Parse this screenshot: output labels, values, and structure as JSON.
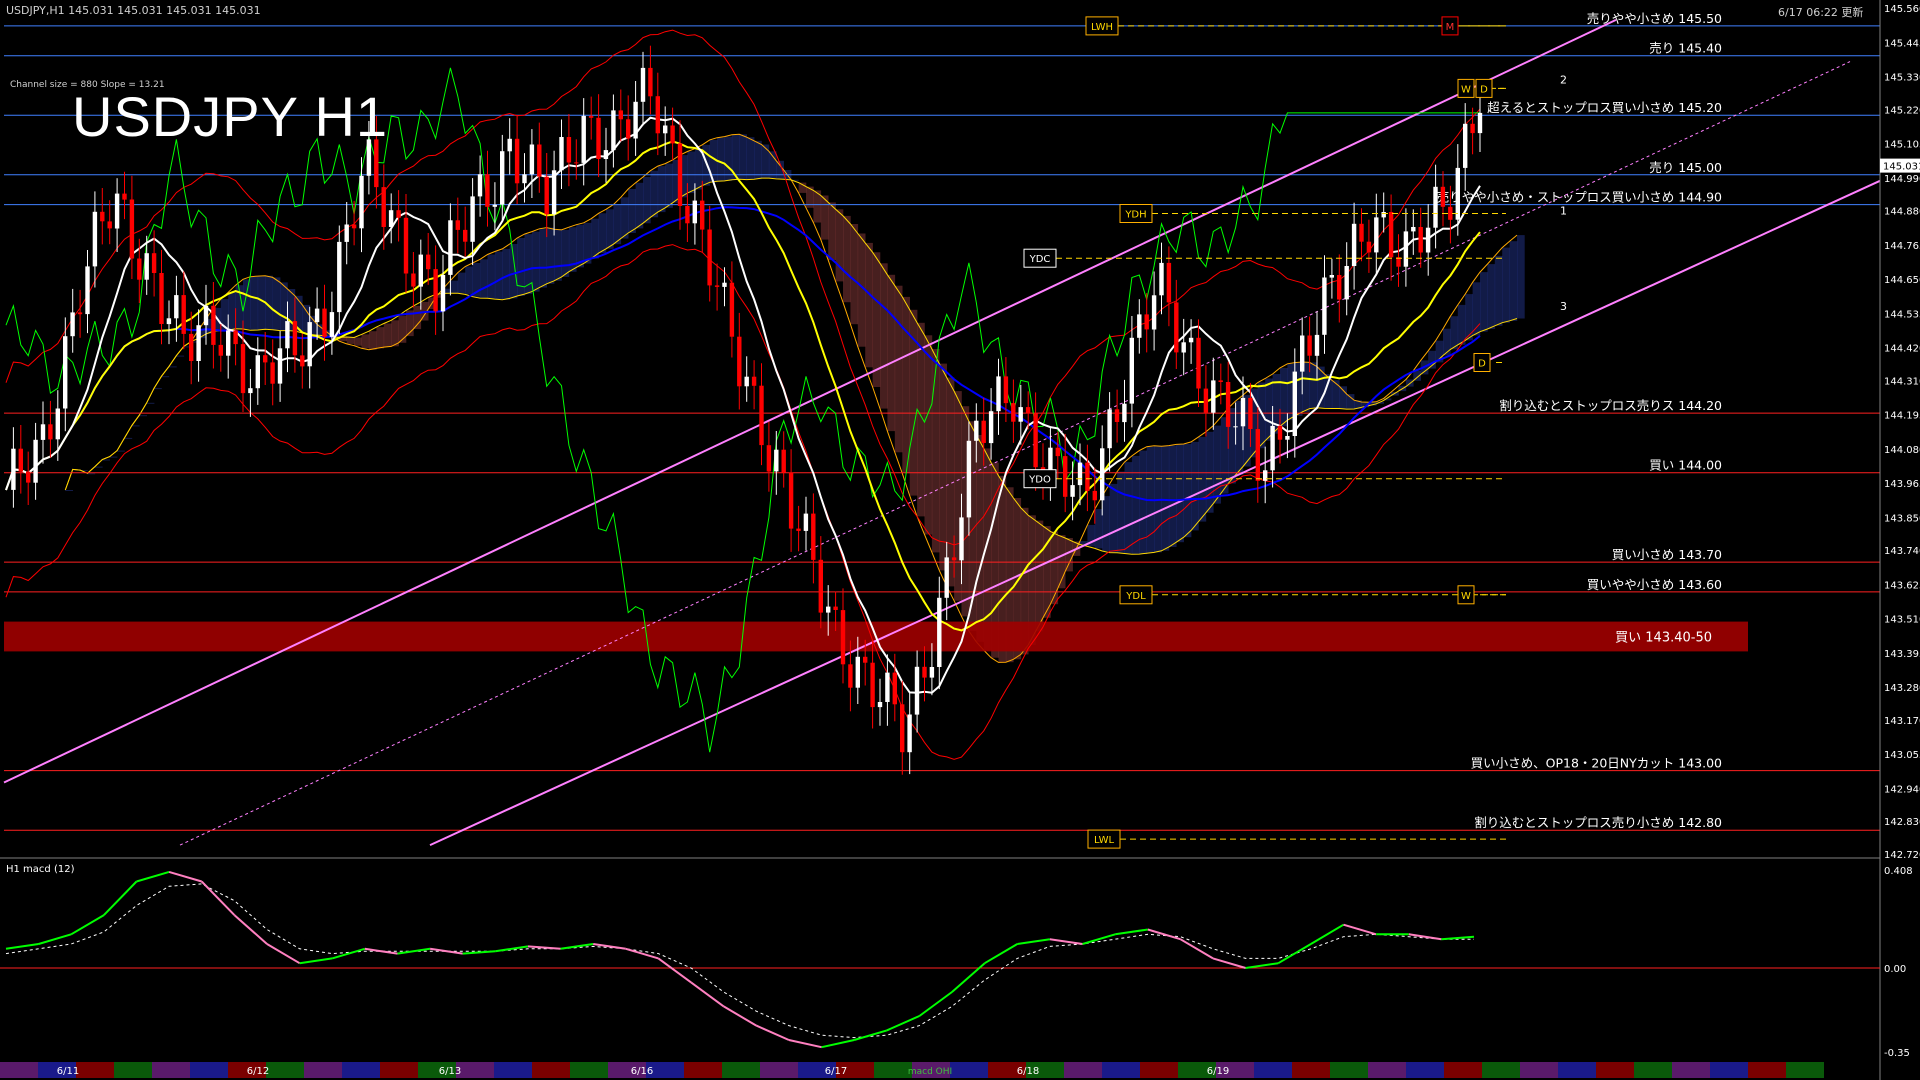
{
  "header": {
    "symbol_info": "USDJPY,H1  145.031 145.031 145.031 145.031",
    "update_time": "6/17 06:22 更新",
    "channel_info": "Channel size = 880 Slope = 13.21",
    "big_title": "USDJPY H1"
  },
  "colors": {
    "bg": "#000000",
    "bull_candle": "#ffffff",
    "bear_candle": "#ff0000",
    "ma_fast": "#ffffff",
    "ma_mid": "#ffff00",
    "ma_slow": "#0000ff",
    "chikou": "#00ff00",
    "bollinger": "#ff0000",
    "channel": "#ff80ff",
    "res_line": "#4080ff",
    "sup_line": "#ff2020",
    "buy_zone": "#a00000",
    "kumo_bull": "#4060ff",
    "kumo_bear": "#ff7070",
    "macd": "#00ff00",
    "macd_neg": "#ff80c0",
    "signal": "#ffffff"
  },
  "chart_data": [
    {
      "type": "candlestick",
      "symbol": "USDJPY",
      "timeframe": "H1",
      "ylim": [
        142.72,
        145.56
      ],
      "y_ticks": [
        "145.560",
        "145.445",
        "145.330",
        "145.220",
        "145.105",
        "144.990",
        "144.880",
        "144.765",
        "144.650",
        "144.535",
        "144.420",
        "144.310",
        "144.195",
        "144.080",
        "143.965",
        "143.850",
        "143.740",
        "143.625",
        "143.510",
        "143.395",
        "143.280",
        "143.170",
        "143.055",
        "142.940",
        "142.830",
        "142.720"
      ],
      "current_price": "145.031",
      "x_labels": [
        "6/11",
        "6/12",
        "6/13",
        "6/16",
        "6/17",
        "6/18",
        "6/19"
      ],
      "close_path": [
        143.9,
        144.1,
        144.6,
        144.9,
        144.7,
        144.4,
        144.5,
        144.3,
        144.4,
        144.6,
        145.0,
        144.8,
        144.6,
        144.9,
        145.1,
        144.9,
        145.2,
        145.1,
        145.3,
        144.9,
        144.5,
        144.2,
        143.8,
        143.5,
        143.3,
        143.1,
        143.6,
        144.1,
        144.3,
        144.0,
        143.9,
        144.3,
        144.6,
        144.4,
        144.2,
        144.0,
        144.4,
        144.6,
        144.9,
        144.7,
        144.9,
        145.3
      ],
      "levels": [
        {
          "price": 145.5,
          "label": "売りやや小さめ 145.50",
          "kind": "resistance"
        },
        {
          "price": 145.4,
          "label": "売り 145.40",
          "kind": "resistance"
        },
        {
          "price": 145.2,
          "label": "超えるとストップロス買い小さめ 145.20",
          "kind": "resistance"
        },
        {
          "price": 145.0,
          "label": "売り 145.00",
          "kind": "resistance"
        },
        {
          "price": 144.9,
          "label": "売りやや小さめ・ストップロス買い小さめ 144.90",
          "kind": "resistance"
        },
        {
          "price": 144.2,
          "label": "割り込むとストップロス売りス 144.20",
          "kind": "support"
        },
        {
          "price": 144.0,
          "label": "買い 144.00",
          "kind": "support"
        },
        {
          "price": 143.7,
          "label": "買い小さめ 143.70",
          "kind": "support"
        },
        {
          "price": 143.6,
          "label": "買いやや小さめ 143.60",
          "kind": "support"
        },
        {
          "price": 143.0,
          "label": "買い小さめ、OP18・20日NYカット 143.00",
          "kind": "support"
        },
        {
          "price": 142.8,
          "label": "割り込むとストップロス売り小さめ 142.80",
          "kind": "support"
        }
      ],
      "zone": {
        "from": 143.4,
        "to": 143.5,
        "label": "買い 143.40-50"
      },
      "markers": [
        {
          "label": "LWH",
          "price": 145.5
        },
        {
          "label": "W",
          "price": 145.29
        },
        {
          "label": "D",
          "price": 145.29
        },
        {
          "label": "M",
          "price": 145.5
        },
        {
          "label": "YDH",
          "price": 144.87
        },
        {
          "label": "YDC",
          "price": 144.72
        },
        {
          "label": "YDO",
          "price": 143.98
        },
        {
          "label": "YDL",
          "price": 143.59
        },
        {
          "label": "D",
          "price": 144.37
        },
        {
          "label": "W",
          "price": 143.59
        },
        {
          "label": "LWL",
          "price": 142.77
        }
      ],
      "projection_labels": [
        "2",
        "1",
        "3"
      ]
    },
    {
      "type": "line",
      "title": "H1  macd (12)",
      "ylim": [
        -0.35,
        0.408
      ],
      "y_ticks": [
        "0.408",
        "0.00",
        "-0.35"
      ],
      "series": [
        {
          "values": [
            0.08,
            0.1,
            0.14,
            0.22,
            0.36,
            0.4,
            0.36,
            0.22,
            0.1,
            0.02,
            0.04,
            0.08,
            0.06,
            0.08,
            0.06,
            0.07,
            0.09,
            0.08,
            0.1,
            0.08,
            0.04,
            -0.06,
            -0.16,
            -0.24,
            -0.3,
            -0.33,
            -0.3,
            -0.26,
            -0.2,
            -0.1,
            0.02,
            0.1,
            0.12,
            0.1,
            0.14,
            0.16,
            0.12,
            0.04,
            0.0,
            0.02,
            0.1,
            0.18,
            0.14,
            0.14,
            0.12,
            0.13
          ]
        },
        {
          "values": [
            0.06,
            0.08,
            0.1,
            0.15,
            0.26,
            0.34,
            0.35,
            0.28,
            0.16,
            0.08,
            0.06,
            0.07,
            0.07,
            0.07,
            0.07,
            0.07,
            0.08,
            0.08,
            0.09,
            0.08,
            0.06,
            0.0,
            -0.1,
            -0.18,
            -0.24,
            -0.28,
            -0.29,
            -0.28,
            -0.24,
            -0.16,
            -0.05,
            0.04,
            0.09,
            0.1,
            0.12,
            0.14,
            0.13,
            0.08,
            0.04,
            0.04,
            0.08,
            0.13,
            0.14,
            0.13,
            0.12,
            0.12
          ]
        }
      ]
    }
  ],
  "timeline": [
    "6/11",
    "6/12",
    "6/13",
    "6/16",
    "6/17",
    "6/18",
    "6/19"
  ],
  "timeline_sub": "macd OHI"
}
